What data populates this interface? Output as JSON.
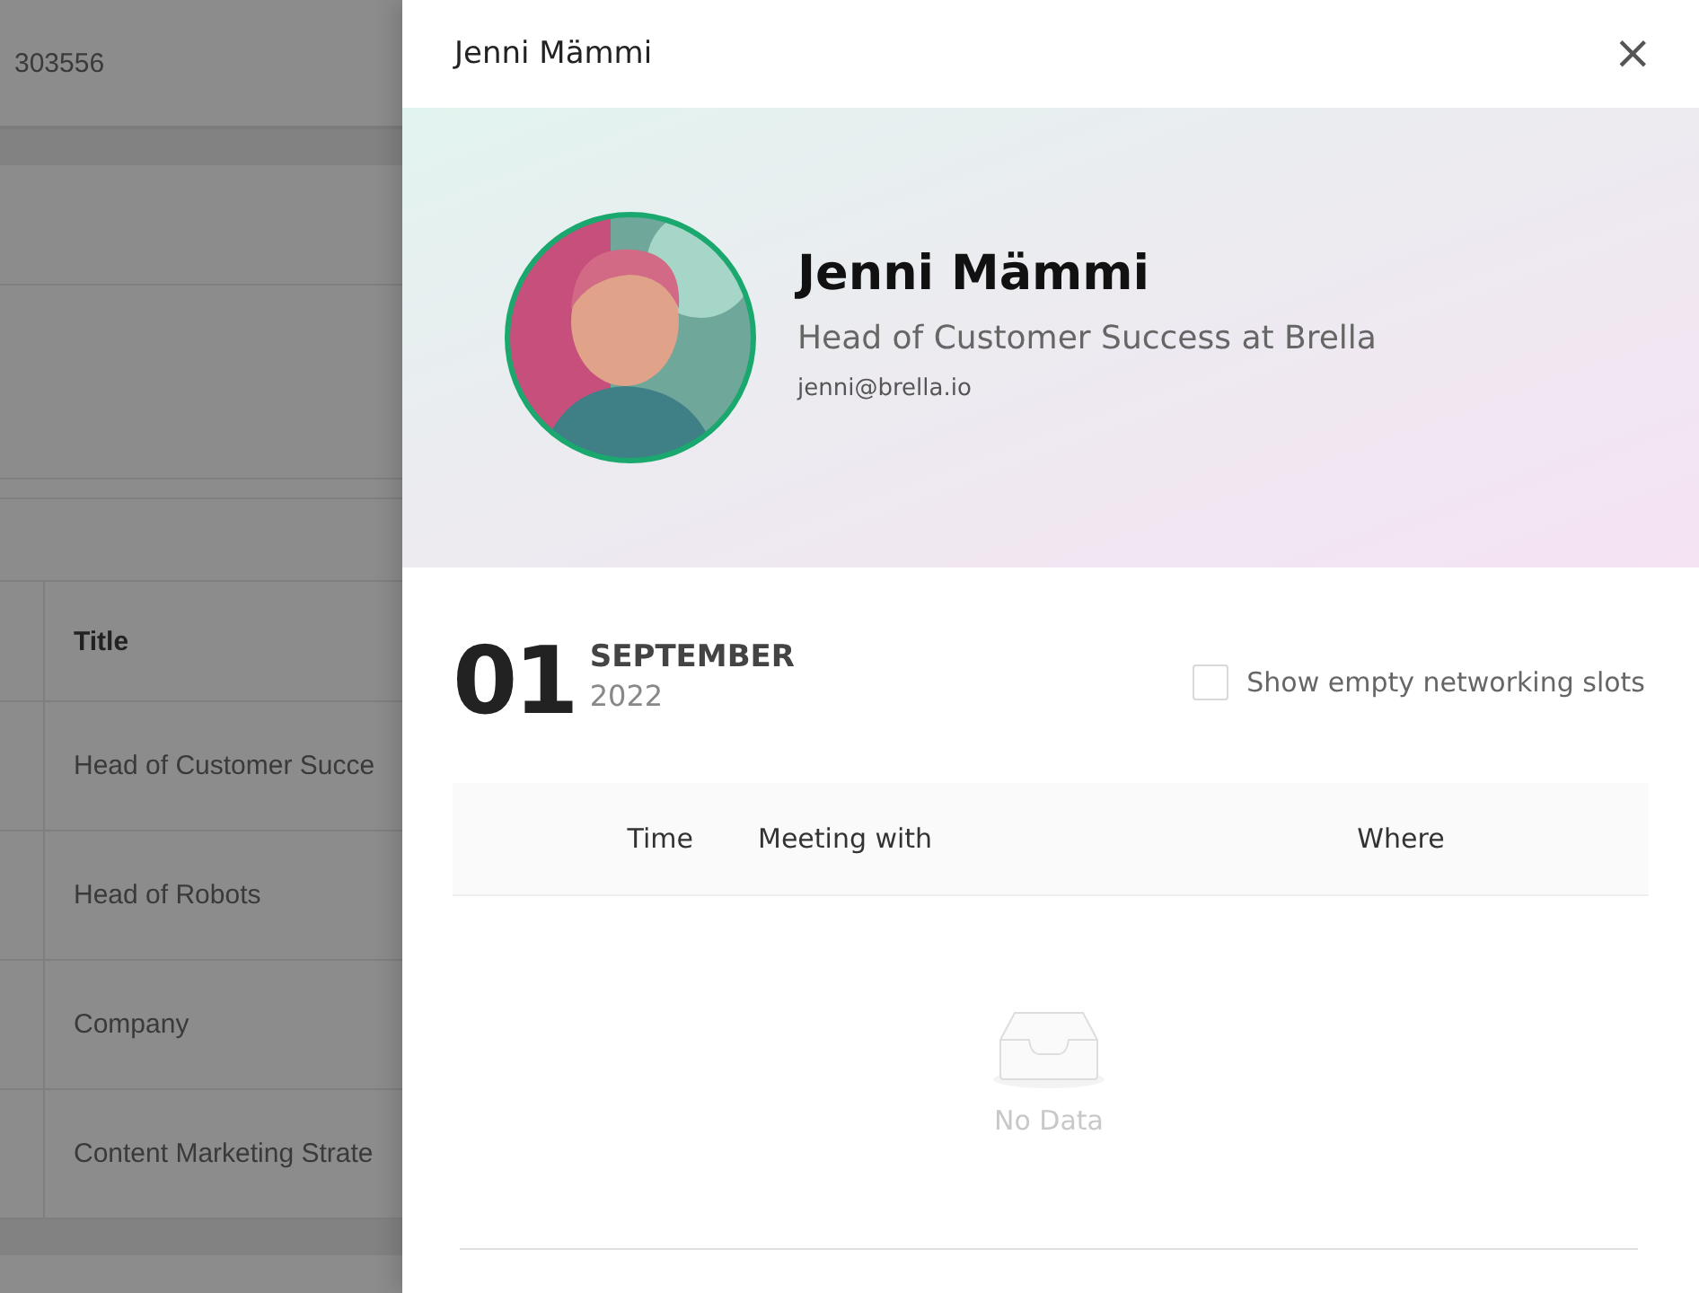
{
  "background_page": {
    "id_value": "303556",
    "table": {
      "column_header": "Title",
      "rows": [
        "Head of Customer Succe",
        "Head of Robots",
        "Company",
        "Content Marketing Strate"
      ]
    }
  },
  "drawer": {
    "title": "Jenni Mämmi",
    "close_icon": "×",
    "profile": {
      "name": "Jenni Mämmi",
      "job_title": "Head of Customer Success at Brella",
      "email": "jenni@brella.io"
    },
    "date": {
      "day": "01",
      "month": "SEPTEMBER",
      "year": "2022"
    },
    "show_empty_slots": {
      "label": "Show empty networking slots",
      "checked": false
    },
    "table": {
      "columns": [
        "Time",
        "Meeting with",
        "Where"
      ],
      "empty_text": "No Data"
    }
  }
}
